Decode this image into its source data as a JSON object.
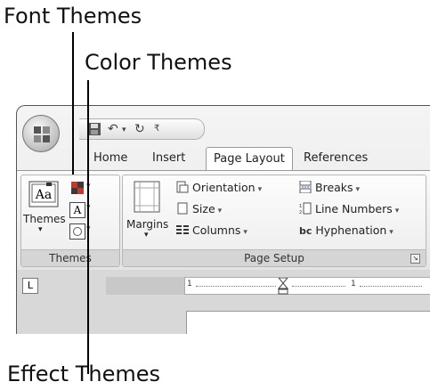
{
  "callouts": {
    "font_themes": "Font Themes",
    "color_themes": "Color Themes",
    "effect_themes": "Effect Themes"
  },
  "tabs": [
    "Home",
    "Insert",
    "Page Layout",
    "References"
  ],
  "active_tab": "Page Layout",
  "themes_group": {
    "themes_label": "Themes",
    "group_label": "Themes",
    "icon_text": "Aa"
  },
  "page_setup_group": {
    "margins_label": "Margins",
    "orientation_label": "Orientation",
    "size_label": "Size",
    "columns_label": "Columns",
    "breaks_label": "Breaks",
    "line_numbers_label": "Line Numbers",
    "hyphenation_label": "Hyphenation",
    "group_label": "Page Setup"
  },
  "ruler": {
    "tab_marker": "L",
    "mark_1": "1",
    "mark_2": "1"
  },
  "colors": {
    "color_theme_red": "#c0392b",
    "color_theme_dark": "#3a3a3a"
  }
}
